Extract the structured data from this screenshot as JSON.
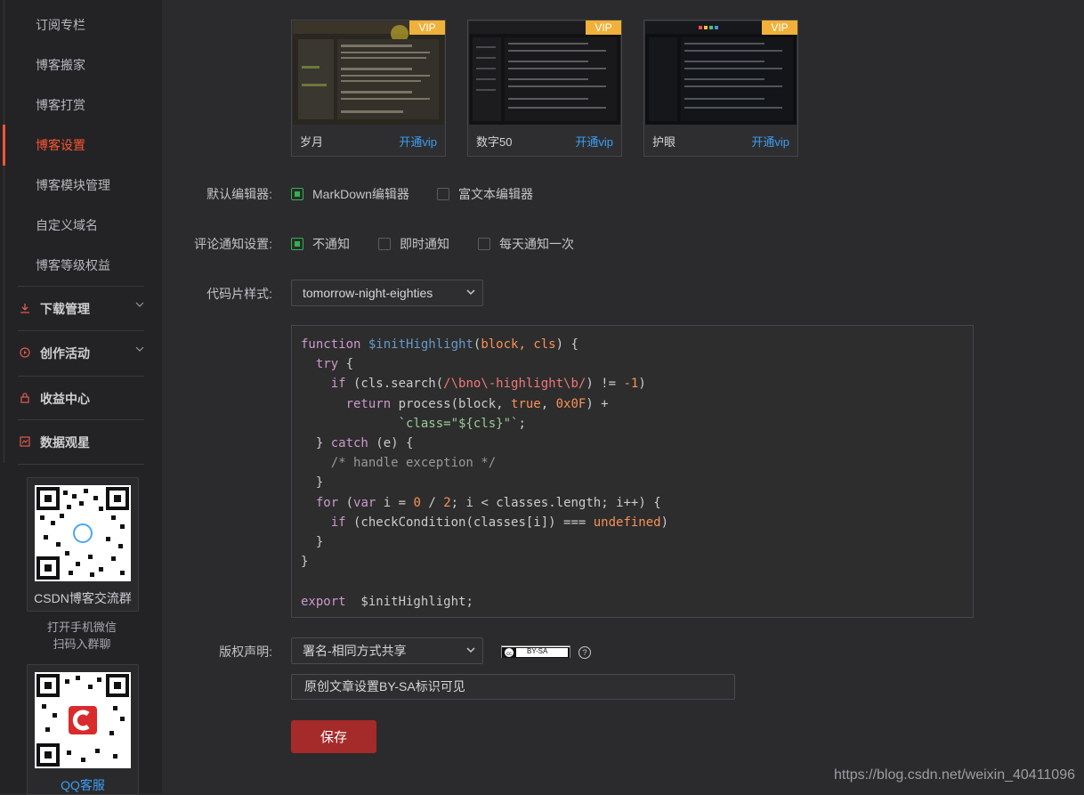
{
  "sidebar": {
    "items": [
      {
        "label": "订阅专栏"
      },
      {
        "label": "博客搬家"
      },
      {
        "label": "博客打赏"
      },
      {
        "label": "博客设置",
        "active": true
      },
      {
        "label": "博客模块管理"
      },
      {
        "label": "自定义域名"
      },
      {
        "label": "博客等级权益"
      }
    ],
    "groups": [
      {
        "label": "下载管理",
        "icon": "download-icon",
        "expandable": true
      },
      {
        "label": "创作活动",
        "icon": "play-circle-icon",
        "expandable": true
      },
      {
        "label": "收益中心",
        "icon": "lock-icon",
        "expandable": false
      },
      {
        "label": "数据观星",
        "icon": "chart-icon",
        "expandable": false
      }
    ],
    "qr_group": {
      "caption": "CSDN博客交流群",
      "note_line1": "打开手机微信",
      "note_line2": "扫码入群聊"
    },
    "qr_service": {
      "caption": "QQ客服"
    }
  },
  "themes": [
    {
      "name": "岁月",
      "badge": "VIP",
      "link": "开通vip"
    },
    {
      "name": "数字50",
      "badge": "VIP",
      "link": "开通vip"
    },
    {
      "name": "护眼",
      "badge": "VIP",
      "link": "开通vip"
    }
  ],
  "settings": {
    "editor": {
      "label": "默认编辑器:",
      "options": [
        {
          "label": "MarkDown编辑器",
          "checked": true
        },
        {
          "label": "富文本编辑器",
          "checked": false
        }
      ]
    },
    "comment_notify": {
      "label": "评论通知设置:",
      "options": [
        {
          "label": "不通知",
          "checked": true
        },
        {
          "label": "即时通知",
          "checked": false
        },
        {
          "label": "每天通知一次",
          "checked": false
        }
      ]
    },
    "code_style": {
      "label": "代码片样式:",
      "value": "tomorrow-night-eighties"
    },
    "copyright": {
      "label": "版权声明:",
      "value": "署名-相同方式共享",
      "badge_text": "BY-SA",
      "help": "?"
    },
    "copyright_note": "原创文章设置BY-SA标识可见",
    "save_label": "保存"
  },
  "colors": {
    "accent": "#fc5531",
    "check": "#2fb34a",
    "link": "#3d9ef1",
    "save": "#a52a2a",
    "vip": "#f0b13a"
  },
  "watermark": "https://blog.csdn.net/weixin_40411096"
}
